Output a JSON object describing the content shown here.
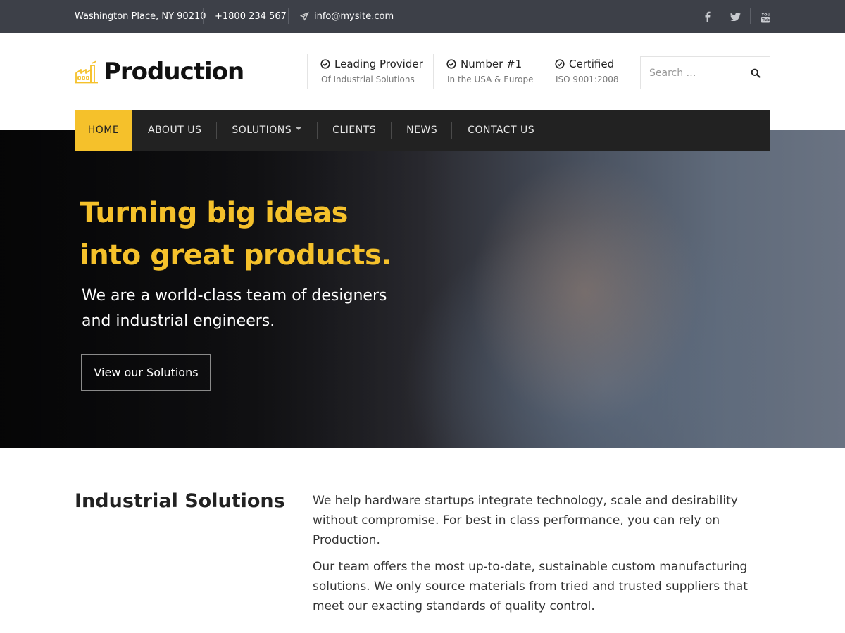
{
  "topbar": {
    "address": "Washington Place, NY 90210",
    "phone": "+1800 234 567",
    "email": "info@mysite.com",
    "social": [
      "facebook-icon",
      "twitter-icon",
      "youtube-icon"
    ]
  },
  "header": {
    "logo_text": "Production",
    "features": [
      {
        "title": "Leading Provider",
        "subtitle": "Of Industrial Solutions"
      },
      {
        "title": "Number #1",
        "subtitle": "In the USA & Europe"
      },
      {
        "title": "Certified",
        "subtitle": "ISO 9001:2008"
      }
    ],
    "search_placeholder": "Search …"
  },
  "nav": {
    "items": [
      {
        "label": "HOME"
      },
      {
        "label": "ABOUT US"
      },
      {
        "label": "SOLUTIONS"
      },
      {
        "label": "CLIENTS"
      },
      {
        "label": "NEWS"
      },
      {
        "label": "CONTACT US"
      }
    ]
  },
  "hero": {
    "title_line1": "Turning big ideas",
    "title_line2": "into great products.",
    "sub_line1": "We are a world-class team of designers",
    "sub_line2": "and industrial engineers.",
    "button": "View our Solutions"
  },
  "section": {
    "title": "Industrial Solutions",
    "paragraph1": "We help hardware startups integrate technology, scale and desirability without compromise. For best in class performance, you can rely on Production.",
    "paragraph2": "Our team offers the most up-to-date, sustainable custom manufacturing solutions. We only source materials from tried and trusted suppliers that meet our exacting standards of quality control."
  },
  "colors": {
    "accent": "#f5c12b",
    "topbar": "#3d4048",
    "nav": "#222222"
  }
}
